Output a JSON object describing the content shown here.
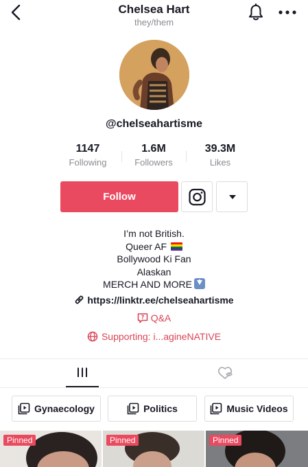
{
  "header": {
    "title": "Chelsea Hart",
    "pronouns": "they/them"
  },
  "profile": {
    "username": "@chelseahartisme"
  },
  "stats": [
    {
      "value": "1147",
      "label": "Following"
    },
    {
      "value": "1.6M",
      "label": "Followers"
    },
    {
      "value": "39.3M",
      "label": "Likes"
    }
  ],
  "actions": {
    "follow_label": "Follow"
  },
  "bio": {
    "lines": [
      "I’m not British.",
      "Queer AF",
      "Bollywood Ki Fan",
      "Alaskan",
      "MERCH AND MORE"
    ],
    "link": "https://linktr.ee/chelseahartisme",
    "qa": "Q&A",
    "supporting": "Supporting: i...agineNATIVE"
  },
  "playlists": [
    {
      "label": "Gynaecology"
    },
    {
      "label": "Politics"
    },
    {
      "label": "Music Videos"
    }
  ],
  "videos": [
    {
      "badge": "Pinned"
    },
    {
      "badge": "Pinned"
    },
    {
      "badge": "Pinned"
    }
  ],
  "colors": {
    "accent": "#ea4a5f",
    "link_red": "#d94455",
    "muted": "#8a8b91"
  }
}
